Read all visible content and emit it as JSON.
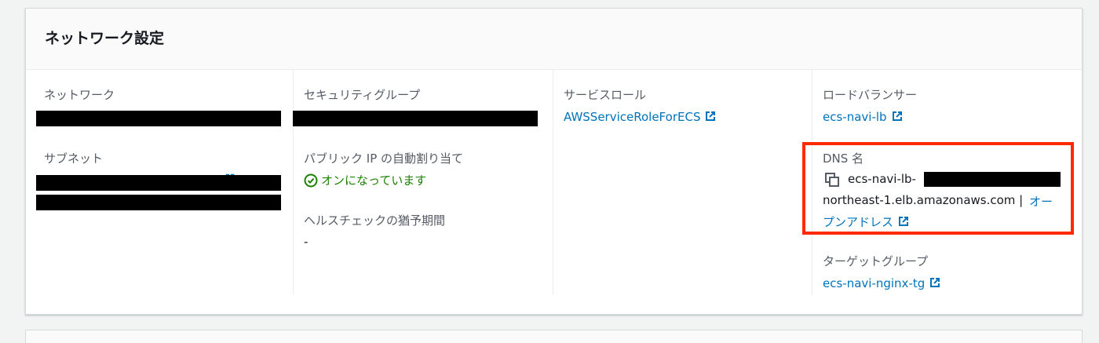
{
  "panel": {
    "title": "ネットワーク設定"
  },
  "network": {
    "label": "ネットワーク",
    "subnet_label": "サブネット"
  },
  "security": {
    "group_label": "セキュリティグループ",
    "public_ip_label": "パブリック IP の自動割り当て",
    "public_ip_status": "オンになっています",
    "health_check_label": "ヘルスチェックの猶予期間",
    "health_check_value": "-"
  },
  "service_role": {
    "label": "サービスロール",
    "link": "AWSServiceRoleForECS"
  },
  "load_balancer": {
    "label": "ロードバランサー",
    "link": "ecs-navi-lb",
    "dns_label": "DNS 名",
    "dns_prefix": "ecs-navi-lb-",
    "dns_line2": "northeast-1.elb.amazonaws.com |",
    "dns_open_link_part1": "オー",
    "dns_open_link_part2": "プンアドレス",
    "target_group_label": "ターゲットグループ",
    "target_group_link": "ecs-navi-nginx-tg"
  },
  "colors": {
    "link": "#0073bb",
    "success": "#1d8102",
    "highlight": "#ff2a00",
    "redaction": "#000000"
  },
  "icons": [
    "external-link-icon",
    "status-success-icon",
    "copy-icon"
  ]
}
